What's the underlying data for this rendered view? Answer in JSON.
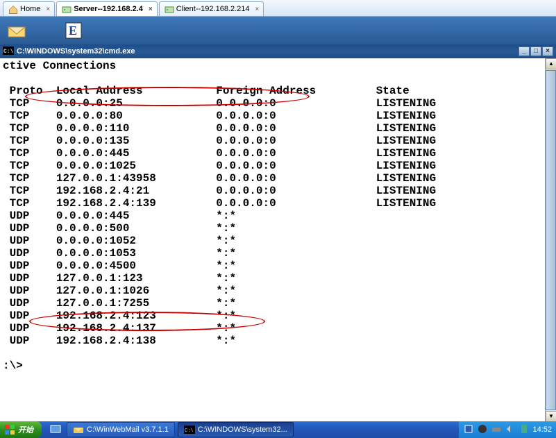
{
  "tabs": [
    {
      "label": "Home",
      "icon": "home-icon",
      "active": false
    },
    {
      "label": "Server--192.168.2.4",
      "icon": "server-icon",
      "active": true
    },
    {
      "label": "Client--192.168.2.214",
      "icon": "client-icon",
      "active": false
    }
  ],
  "cmd": {
    "title": "C:\\WINDOWS\\system32\\cmd.exe",
    "heading": "ctive Connections",
    "columns": {
      "proto": "Proto",
      "local": "Local Address",
      "foreign": "Foreign Address",
      "state": "State"
    },
    "rows": [
      {
        "proto": "TCP",
        "local": "0.0.0.0:25",
        "foreign": "0.0.0.0:0",
        "state": "LISTENING"
      },
      {
        "proto": "TCP",
        "local": "0.0.0.0:80",
        "foreign": "0.0.0.0:0",
        "state": "LISTENING"
      },
      {
        "proto": "TCP",
        "local": "0.0.0.0:110",
        "foreign": "0.0.0.0:0",
        "state": "LISTENING"
      },
      {
        "proto": "TCP",
        "local": "0.0.0.0:135",
        "foreign": "0.0.0.0:0",
        "state": "LISTENING"
      },
      {
        "proto": "TCP",
        "local": "0.0.0.0:445",
        "foreign": "0.0.0.0:0",
        "state": "LISTENING"
      },
      {
        "proto": "TCP",
        "local": "0.0.0.0:1025",
        "foreign": "0.0.0.0:0",
        "state": "LISTENING"
      },
      {
        "proto": "TCP",
        "local": "127.0.0.1:43958",
        "foreign": "0.0.0.0:0",
        "state": "LISTENING"
      },
      {
        "proto": "TCP",
        "local": "192.168.2.4:21",
        "foreign": "0.0.0.0:0",
        "state": "LISTENING"
      },
      {
        "proto": "TCP",
        "local": "192.168.2.4:139",
        "foreign": "0.0.0.0:0",
        "state": "LISTENING"
      },
      {
        "proto": "UDP",
        "local": "0.0.0.0:445",
        "foreign": "*:*",
        "state": ""
      },
      {
        "proto": "UDP",
        "local": "0.0.0.0:500",
        "foreign": "*:*",
        "state": ""
      },
      {
        "proto": "UDP",
        "local": "0.0.0.0:1052",
        "foreign": "*:*",
        "state": ""
      },
      {
        "proto": "UDP",
        "local": "0.0.0.0:1053",
        "foreign": "*:*",
        "state": ""
      },
      {
        "proto": "UDP",
        "local": "0.0.0.0:4500",
        "foreign": "*:*",
        "state": ""
      },
      {
        "proto": "UDP",
        "local": "127.0.0.1:123",
        "foreign": "*:*",
        "state": ""
      },
      {
        "proto": "UDP",
        "local": "127.0.0.1:1026",
        "foreign": "*:*",
        "state": ""
      },
      {
        "proto": "UDP",
        "local": "127.0.0.1:7255",
        "foreign": "*:*",
        "state": ""
      },
      {
        "proto": "UDP",
        "local": "192.168.2.4:123",
        "foreign": "*:*",
        "state": ""
      },
      {
        "proto": "UDP",
        "local": "192.168.2.4:137",
        "foreign": "*:*",
        "state": ""
      },
      {
        "proto": "UDP",
        "local": "192.168.2.4:138",
        "foreign": "*:*",
        "state": ""
      }
    ],
    "prompt": ":\\>"
  },
  "taskbar": {
    "start": "开始",
    "items": [
      {
        "label": "C:\\WinWebMail v3.7.1.1",
        "active": false
      },
      {
        "label": "C:\\WINDOWS\\system32...",
        "active": true
      }
    ],
    "clock": "14:52"
  }
}
